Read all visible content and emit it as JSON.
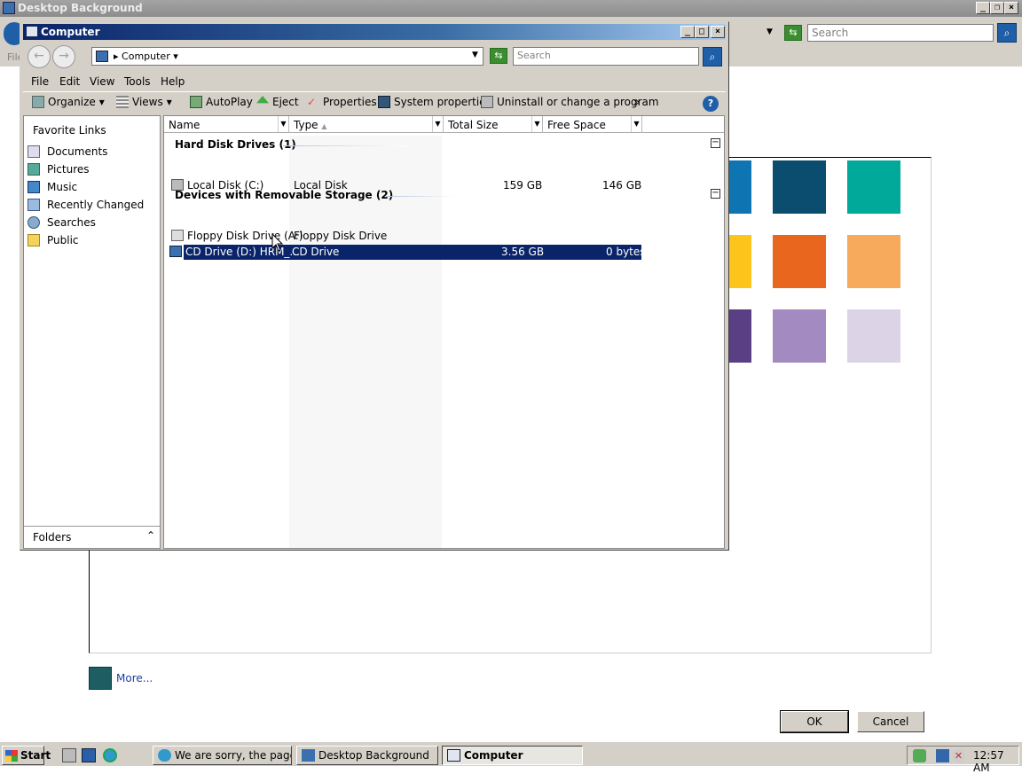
{
  "bg_window": {
    "title": "Desktop Background",
    "search_placeholder": "Search",
    "menu_partial": "File",
    "more_link": "More...",
    "ok_label": "OK",
    "cancel_label": "Cancel",
    "swatch_colors": [
      "#0e74b2",
      "#0b4d6e",
      "#00a99a",
      "#fdc41b",
      "#e9661f",
      "#f7aa5b",
      "#5a3f85",
      "#a38ac1",
      "#dcd3e6"
    ]
  },
  "window": {
    "title": "Computer",
    "address": "Computer",
    "search_placeholder": "Search",
    "menu": [
      "File",
      "Edit",
      "View",
      "Tools",
      "Help"
    ],
    "toolbar": {
      "organize": "Organize",
      "views": "Views",
      "autoplay": "AutoPlay",
      "eject": "Eject",
      "properties": "Properties",
      "system_properties": "System properties",
      "uninstall": "Uninstall or change a program",
      "more": "»"
    }
  },
  "left_pane": {
    "header": "Favorite Links",
    "links": [
      "Documents",
      "Pictures",
      "Music",
      "Recently Changed",
      "Searches",
      "Public"
    ],
    "folders_label": "Folders"
  },
  "columns": [
    "Name",
    "Type",
    "Total Size",
    "Free Space"
  ],
  "groups": [
    {
      "title": "Hard Disk Drives (1)",
      "items": [
        {
          "name": "Local Disk (C:)",
          "type": "Local Disk",
          "total": "159 GB",
          "free": "146 GB"
        }
      ]
    },
    {
      "title": "Devices with Removable Storage (2)",
      "items": [
        {
          "name": "Floppy Disk Drive (A:)",
          "type": "Floppy Disk Drive",
          "total": "",
          "free": ""
        },
        {
          "name": "CD Drive (D:) HRM_...",
          "type": "CD Drive",
          "total": "3.56 GB",
          "free": "0 bytes"
        }
      ]
    }
  ],
  "taskbar": {
    "start": "Start",
    "tasks": [
      "We are sorry, the page yo...",
      "Desktop Background",
      "Computer"
    ],
    "clock": "12:57 AM"
  }
}
